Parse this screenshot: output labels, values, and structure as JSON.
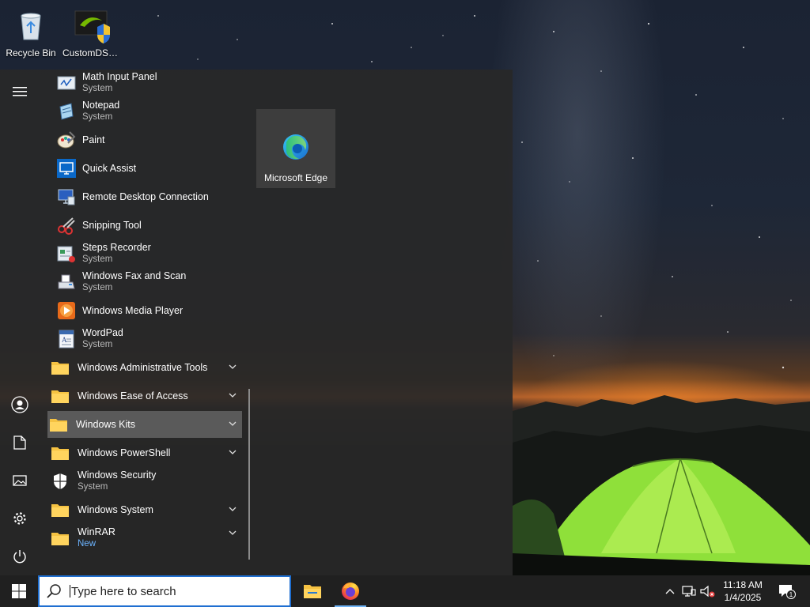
{
  "desktop": {
    "icons": [
      {
        "label": "Recycle Bin",
        "icon": "recycle-bin-icon"
      },
      {
        "label": "CustomDSR...",
        "icon": "nvidia-shield-icon"
      }
    ]
  },
  "start_menu": {
    "rail": [
      {
        "icon": "hamburger-menu-icon"
      },
      {
        "icon": "user-icon"
      },
      {
        "icon": "documents-icon"
      },
      {
        "icon": "pictures-icon"
      },
      {
        "icon": "settings-gear-icon"
      },
      {
        "icon": "power-icon"
      }
    ],
    "apps": [
      {
        "name": "Math Input Panel",
        "sub": "System",
        "icon": "math-input-icon"
      },
      {
        "name": "Notepad",
        "sub": "System",
        "icon": "notepad-icon"
      },
      {
        "name": "Paint",
        "icon": "paint-icon"
      },
      {
        "name": "Quick Assist",
        "icon": "quick-assist-icon"
      },
      {
        "name": "Remote Desktop Connection",
        "icon": "remote-desktop-icon"
      },
      {
        "name": "Snipping Tool",
        "icon": "snipping-tool-icon"
      },
      {
        "name": "Steps Recorder",
        "sub": "System",
        "icon": "steps-recorder-icon"
      },
      {
        "name": "Windows Fax and Scan",
        "sub": "System",
        "icon": "fax-scan-icon"
      },
      {
        "name": "Windows Media Player",
        "icon": "media-player-icon"
      },
      {
        "name": "WordPad",
        "sub": "System",
        "icon": "wordpad-icon"
      }
    ],
    "folders": [
      {
        "name": "Windows Administrative Tools",
        "icon": "folder-icon",
        "expandable": true
      },
      {
        "name": "Windows Ease of Access",
        "icon": "folder-icon",
        "expandable": true
      },
      {
        "name": "Windows Kits",
        "icon": "folder-icon",
        "expandable": true,
        "highlighted": true
      },
      {
        "name": "Windows PowerShell",
        "icon": "folder-icon",
        "expandable": true
      },
      {
        "name": "Windows Security",
        "sub": "System",
        "icon": "shield-icon",
        "expandable": false
      },
      {
        "name": "Windows System",
        "icon": "folder-icon",
        "expandable": true
      },
      {
        "name": "WinRAR",
        "sub": "New",
        "icon": "folder-icon",
        "expandable": true
      }
    ],
    "tiles": [
      {
        "label": "Microsoft Edge",
        "icon": "edge-icon"
      }
    ]
  },
  "taskbar": {
    "search_placeholder": "Type here to search",
    "pinned": [
      {
        "name": "File Explorer",
        "icon": "file-explorer-icon"
      },
      {
        "name": "Firefox",
        "icon": "firefox-icon",
        "active": true
      }
    ],
    "tray": {
      "time": "11:18 AM",
      "date": "1/4/2025",
      "notification_count": "1"
    }
  },
  "colors": {
    "accent": "#1f6fd1",
    "start_bg": "#282828",
    "taskbar_bg": "#202020",
    "folder_yellow": "#f5c242",
    "highlight": "#5a5a5a"
  }
}
